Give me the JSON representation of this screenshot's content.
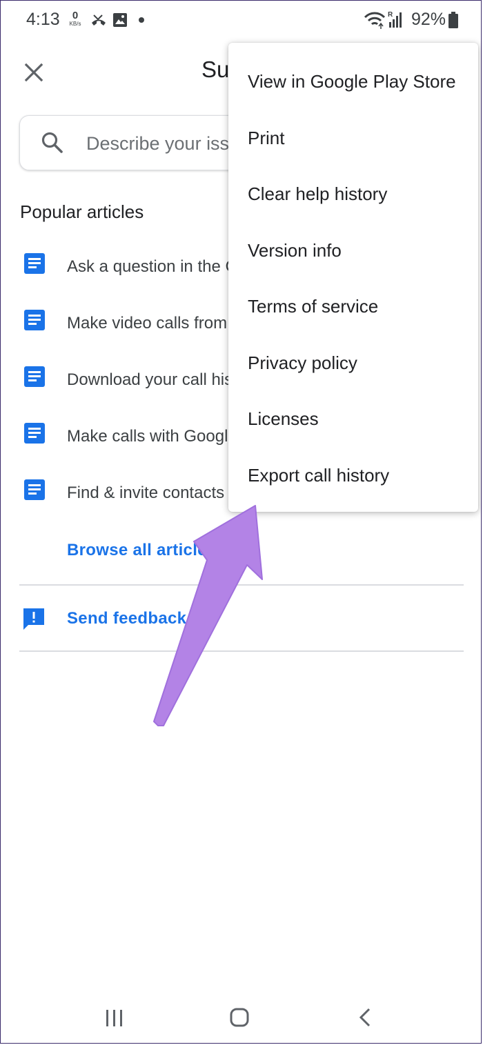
{
  "status_bar": {
    "time": "4:13",
    "data_speed": "0",
    "data_unit": "KB/s",
    "battery": "92%"
  },
  "header": {
    "title": "Su"
  },
  "search": {
    "placeholder": "Describe your iss"
  },
  "popular_articles": {
    "heading": "Popular articles",
    "items": [
      {
        "label": "Ask a question in the C"
      },
      {
        "label": "Make video calls from"
      },
      {
        "label": "Download your call his"
      },
      {
        "label": "Make calls with Google"
      },
      {
        "label": "Find & invite contacts"
      }
    ],
    "browse_all": "Browse all articles"
  },
  "feedback": {
    "label": "Send feedback"
  },
  "overflow_menu": {
    "items": [
      {
        "label": "View in Google Play Store"
      },
      {
        "label": "Print"
      },
      {
        "label": "Clear help history"
      },
      {
        "label": "Version info"
      },
      {
        "label": "Terms of service"
      },
      {
        "label": "Privacy policy"
      },
      {
        "label": "Licenses"
      },
      {
        "label": "Export call history"
      }
    ]
  },
  "colors": {
    "accent": "#1a73e8",
    "arrow": "#b383e6",
    "text": "#202124"
  },
  "icons": [
    "close-icon",
    "search-icon",
    "document-icon",
    "feedback-icon",
    "recents-icon",
    "home-icon",
    "back-icon"
  ]
}
